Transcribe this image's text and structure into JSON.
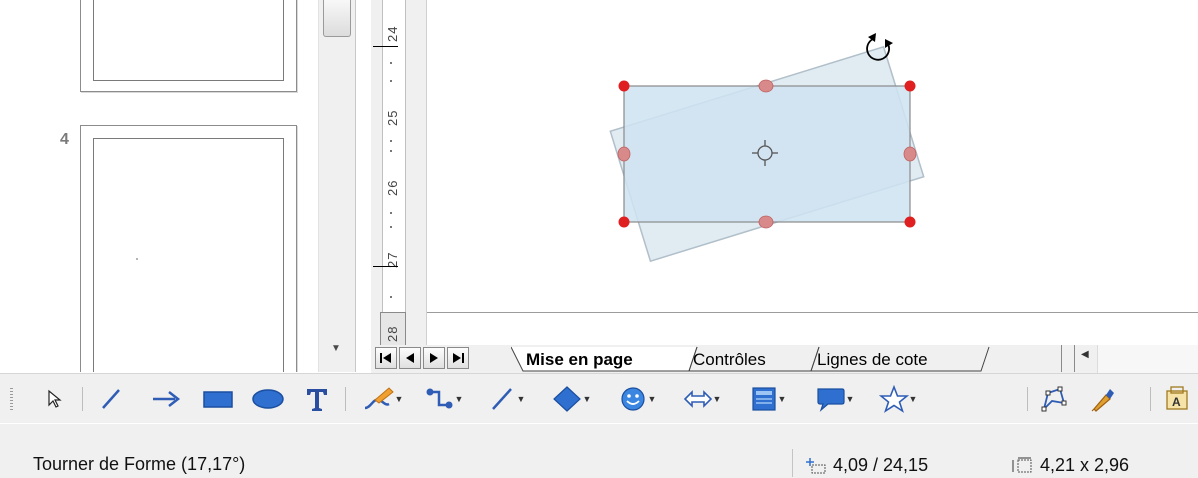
{
  "slide_pane": {
    "slide_number": "4"
  },
  "ruler": {
    "labels": [
      "24",
      "25",
      "26",
      "27",
      "28"
    ]
  },
  "tabs": {
    "items": [
      {
        "label": "Mise en page",
        "active": true
      },
      {
        "label": "Contrôles",
        "active": false
      },
      {
        "label": "Lignes de cote",
        "active": false
      }
    ]
  },
  "toolbar": {
    "icons": [
      "select-arrow-icon",
      "line-icon",
      "line-arrow-icon",
      "rectangle-icon",
      "ellipse-icon",
      "text-icon",
      "curve-icon",
      "connector-icon",
      "lines-arrows-icon",
      "basic-shapes-icon",
      "symbol-shapes-icon",
      "block-arrows-icon",
      "flowchart-icon",
      "callouts-icon",
      "stars-icon",
      "points-icon",
      "glue-points-icon",
      "fontwork-icon"
    ]
  },
  "status": {
    "action": "Tourner de Forme (17,17°)",
    "position": "4,09 / 24,15",
    "size": "4,21 x 2,96"
  },
  "colors": {
    "shape_fill": "#cfe3f2",
    "handle": "#e02020",
    "handle_mid": "#d88a8a"
  }
}
